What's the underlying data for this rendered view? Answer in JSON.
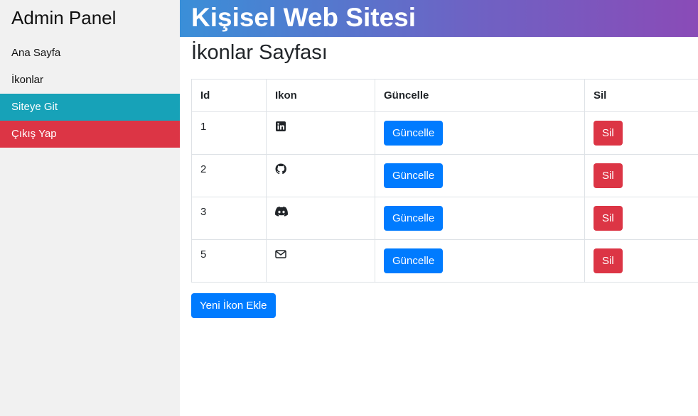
{
  "sidebar": {
    "title": "Admin Panel",
    "items": [
      {
        "label": "Ana Sayfa"
      },
      {
        "label": "İkonlar"
      },
      {
        "label": "Siteye Git"
      },
      {
        "label": "Çıkış Yap"
      }
    ]
  },
  "header": {
    "title": "Kişisel Web Sitesi"
  },
  "main": {
    "page_title": "İkonlar Sayfası",
    "table": {
      "headers": [
        "Id",
        "Ikon",
        "Güncelle",
        "Sil"
      ],
      "rows": [
        {
          "id": "1",
          "icon": "linkedin-icon",
          "update_label": "Güncelle",
          "delete_label": "Sil"
        },
        {
          "id": "2",
          "icon": "github-icon",
          "update_label": "Güncelle",
          "delete_label": "Sil"
        },
        {
          "id": "3",
          "icon": "discord-icon",
          "update_label": "Güncelle",
          "delete_label": "Sil"
        },
        {
          "id": "5",
          "icon": "envelope-icon",
          "update_label": "Güncelle",
          "delete_label": "Sil"
        }
      ]
    },
    "add_button": "Yeni İkon Ekle"
  },
  "colors": {
    "sidebar_bg": "#f1f1f1",
    "teal": "#17a2b8",
    "red": "#dc3545",
    "primary": "#007bff",
    "header_gradient_start": "#3a8fd8",
    "header_gradient_end": "#8a4bb7"
  }
}
